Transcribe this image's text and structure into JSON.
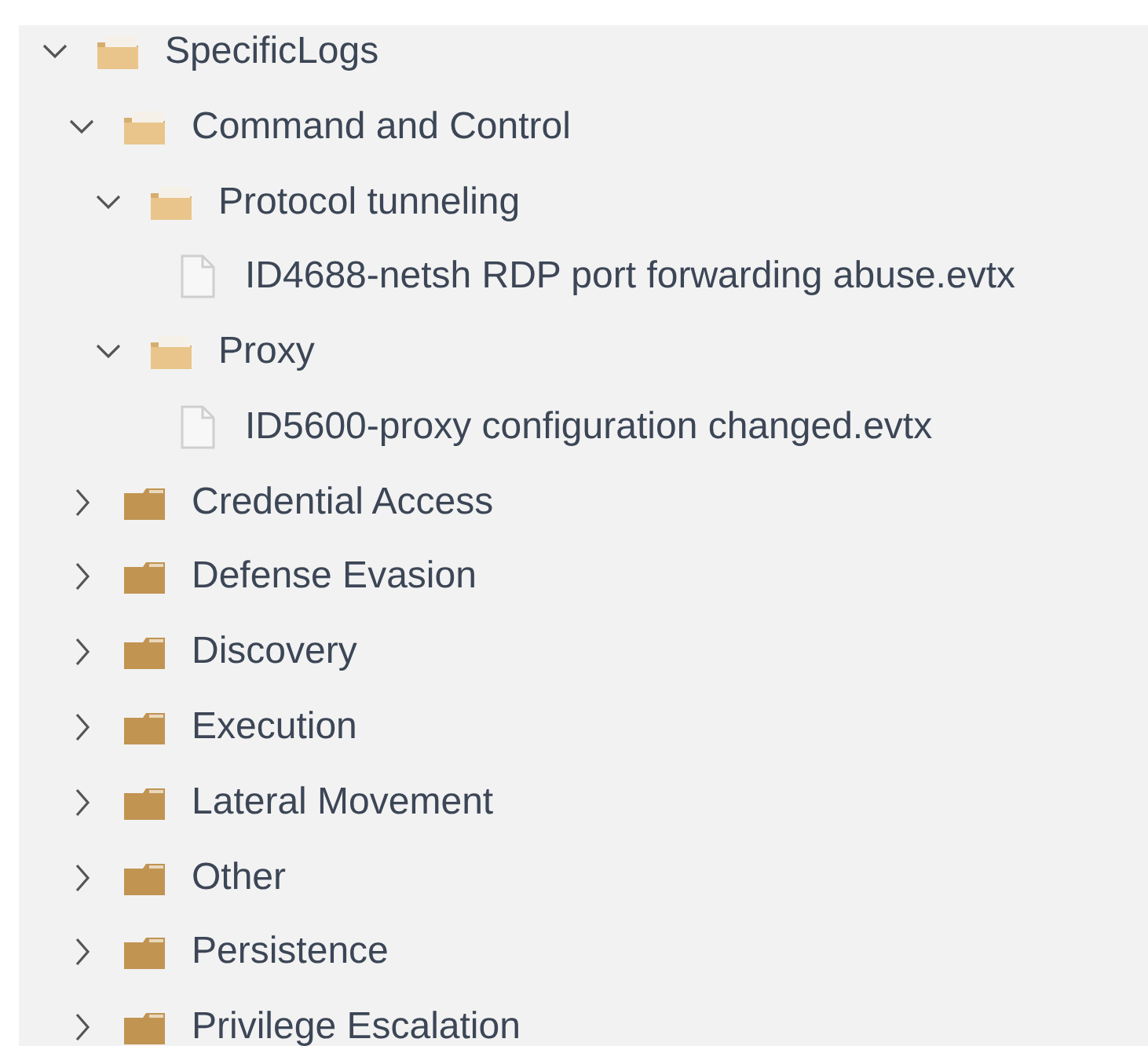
{
  "tree": [
    {
      "kind": "folder",
      "label": "SpecificLogs",
      "expanded": true,
      "children": [
        {
          "kind": "folder",
          "label": "Command and Control",
          "expanded": true,
          "children": [
            {
              "kind": "folder",
              "label": "Protocol tunneling",
              "expanded": true,
              "children": [
                {
                  "kind": "file",
                  "label": "ID4688-netsh RDP port forwarding abuse.evtx"
                }
              ]
            },
            {
              "kind": "folder",
              "label": "Proxy",
              "expanded": true,
              "children": [
                {
                  "kind": "file",
                  "label": "ID5600-proxy configuration changed.evtx"
                }
              ]
            }
          ]
        },
        {
          "kind": "folder",
          "label": "Credential Access",
          "expanded": false
        },
        {
          "kind": "folder",
          "label": "Defense Evasion",
          "expanded": false
        },
        {
          "kind": "folder",
          "label": "Discovery",
          "expanded": false
        },
        {
          "kind": "folder",
          "label": "Execution",
          "expanded": false
        },
        {
          "kind": "folder",
          "label": "Lateral Movement",
          "expanded": false
        },
        {
          "kind": "folder",
          "label": "Other",
          "expanded": false
        },
        {
          "kind": "folder",
          "label": "Persistence",
          "expanded": false
        },
        {
          "kind": "folder",
          "label": "Privilege Escalation",
          "expanded": false
        }
      ]
    }
  ]
}
